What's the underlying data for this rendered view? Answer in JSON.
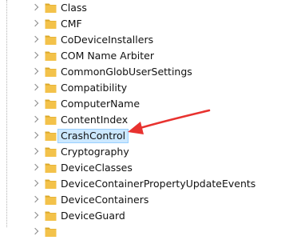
{
  "tree": {
    "items": [
      {
        "label": "Class"
      },
      {
        "label": "CMF"
      },
      {
        "label": "CoDeviceInstallers"
      },
      {
        "label": "COM Name Arbiter"
      },
      {
        "label": "CommonGlobUserSettings"
      },
      {
        "label": "Compatibility"
      },
      {
        "label": "ComputerName"
      },
      {
        "label": "ContentIndex"
      },
      {
        "label": "CrashControl",
        "selected": true
      },
      {
        "label": "Cryptography"
      },
      {
        "label": "DeviceClasses"
      },
      {
        "label": "DeviceContainerPropertyUpdateEvents"
      },
      {
        "label": "DeviceContainers"
      },
      {
        "label": "DeviceGuard"
      },
      {
        "label": ""
      }
    ]
  },
  "colors": {
    "folder": "#f3c24a",
    "folder_dark": "#dba829",
    "selection_bg": "#cce8ff",
    "arrow": "#e8322f"
  },
  "icons": {
    "expander": "chevron-right-icon",
    "folder": "folder-icon",
    "annotation": "red-arrow-annotation"
  }
}
